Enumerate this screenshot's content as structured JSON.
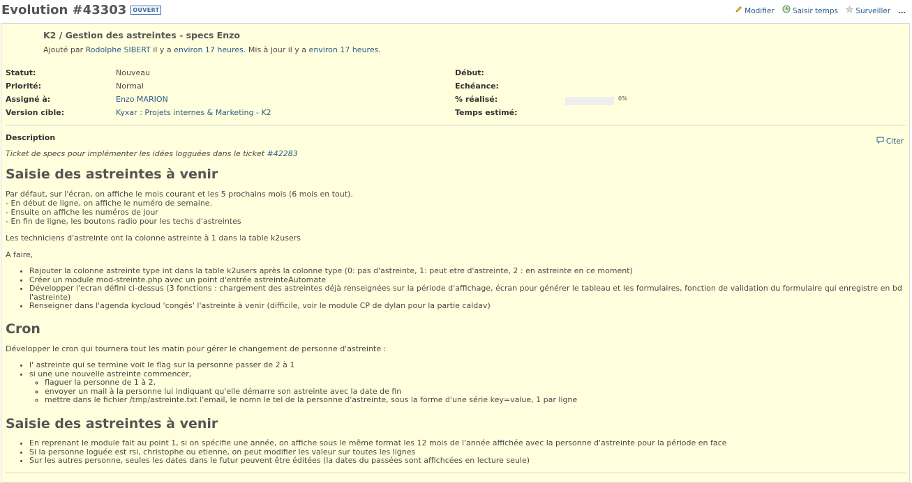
{
  "header": {
    "title": "Evolution #43303",
    "status_badge": "OUVERT",
    "actions": {
      "edit": "Modifier",
      "log_time": "Saisir temps",
      "watch": "Surveiller",
      "more": "…"
    }
  },
  "issue": {
    "subject": "K2 / Gestion des astreintes - specs Enzo",
    "author": {
      "prefix": "Ajouté par",
      "name": "Rodolphe SIBERT",
      "mid1": "il y a",
      "created": "environ 17 heures",
      "mid2": ". Mis à jour il y a",
      "updated": "environ 17 heures",
      "suffix": "."
    },
    "attributes": {
      "status_label": "Statut:",
      "status": "Nouveau",
      "priority_label": "Priorité:",
      "priority": "Normal",
      "assignee_label": "Assigné à:",
      "assignee": "Enzo MARION",
      "version_label": "Version cible:",
      "version": "Kyxar : Projets internes & Marketing - K2",
      "start_label": "Début:",
      "start": "",
      "due_label": "Echéance:",
      "due": "",
      "done_label": "% réalisé:",
      "done": "0%",
      "done_ratio": 0,
      "estimated_label": "Temps estimé:",
      "estimated": ""
    },
    "description_label": "Description",
    "quote": "Citer"
  },
  "wiki": {
    "intro_text": "Ticket de specs pour implémenter les idées logguées dans le ticket",
    "intro_link": "#42283",
    "section1": {
      "title": "Saisie des astreintes à venir",
      "p1_l1": "Par défaut, sur l'écran, on affiche le mois courant et les 5 prochains mois (6 mois en tout).",
      "p1_l2": "- En début de ligne, on affiche le numéro de semaine.",
      "p1_l3": "- Ensuite on affiche les numéros de jour",
      "p1_l4": "- En fin de ligne, les boutons radio pour les techs d'astreintes",
      "p2": "Les techniciens d'astreinte ont la colonne astreinte à 1 dans la table k2users",
      "p3": "A faire,",
      "items": [
        "Rajouter la colonne astreinte type int dans la table k2users après la colonne type (0: pas d'astreinte, 1: peut etre d'astreinte, 2 : en astreinte en ce moment)",
        "Créer un module mod-streinte.php avec un point d'entrée astreinteAutomate",
        "Développer l'ecran défini ci-dessus (3 fonctions : chargement des astreintes déjà renseignées sur la période d'affichage, écran pour générer le tableau et les formulaires, fonction de validation du formulaire qui enregistre en bd l'astreinte)",
        "Renseigner dans l'agenda kycloud 'congés' l'astreinte à venir (difficile, voir le module CP de dylan pour la partie caldav)"
      ]
    },
    "section2": {
      "title": "Cron",
      "p1": "Développer le cron qui tournera tout les matin pour gérer le changement de personne d'astreinte :",
      "item1": "l' astreinte qui se termine voit le flag sur la personne passer de 2 à 1",
      "item2": "si une une nouvelle astreinte commencer,",
      "subitems": [
        "flaguer la personne de 1 à 2,",
        "envoyer un mail à la personne lui indiquant qu'elle démarre son astreinte avec la date de fin",
        "mettre dans le fichier /tmp/astreinte.txt l'email, le nomn le tel de la personne d'astreinte, sous la forme d'une série key=value, 1 par ligne"
      ]
    },
    "section3": {
      "title": "Saisie des astreintes à venir",
      "items": [
        "En reprenant le module fait au point 1, si on spécifie une année, on affiche sous le même format les 12 mois de l'année affichée avec la personne d'astreinte pour la période en face",
        "Si la personne loguée est rsi, christophe ou etienne, on peut modifier les valeur sur toutes les lignes",
        "Sur les autres personne, seules les dates dans le futur peuvent être éditées (la dates du passées sont affichcées en lecture seule)"
      ]
    }
  }
}
